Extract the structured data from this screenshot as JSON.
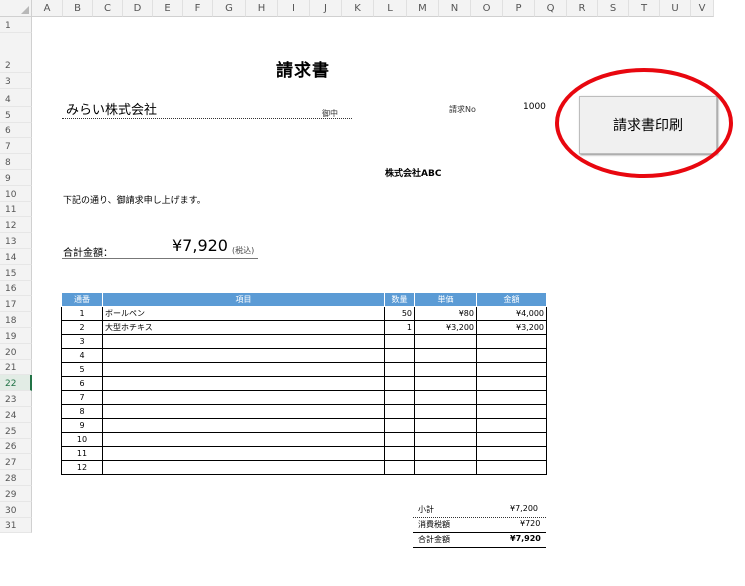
{
  "columns": [
    "A",
    "B",
    "C",
    "D",
    "E",
    "F",
    "G",
    "H",
    "I",
    "J",
    "K",
    "L",
    "M",
    "N",
    "O",
    "P",
    "Q",
    "R",
    "S",
    "T",
    "U",
    "V"
  ],
  "rows": [
    "1",
    "2",
    "3",
    "4",
    "5",
    "6",
    "7",
    "8",
    "9",
    "10",
    "11",
    "12",
    "13",
    "14",
    "15",
    "16",
    "17",
    "18",
    "19",
    "20",
    "21",
    "22",
    "23",
    "24",
    "25",
    "26",
    "27",
    "28",
    "29",
    "30",
    "31"
  ],
  "invoice": {
    "title": "請求書",
    "client": "みらい株式会社",
    "honorific": "御中",
    "invoice_no_label": "請求No",
    "invoice_no": "1000",
    "company": "株式会社ABC",
    "intro": "下記の通り、御請求申し上げます。",
    "total_label": "合計金額：",
    "total_amount": "¥7,920",
    "tax_note": "(税込)",
    "table_headers": [
      "通番",
      "項目",
      "数量",
      "単価",
      "金額"
    ],
    "items": [
      {
        "no": "1",
        "name": "ボールペン",
        "qty": "50",
        "price": "¥80",
        "amount": "¥4,000"
      },
      {
        "no": "2",
        "name": "大型ホチキス",
        "qty": "1",
        "price": "¥3,200",
        "amount": "¥3,200"
      },
      {
        "no": "3",
        "name": "",
        "qty": "",
        "price": "",
        "amount": ""
      },
      {
        "no": "4",
        "name": "",
        "qty": "",
        "price": "",
        "amount": ""
      },
      {
        "no": "5",
        "name": "",
        "qty": "",
        "price": "",
        "amount": ""
      },
      {
        "no": "6",
        "name": "",
        "qty": "",
        "price": "",
        "amount": ""
      },
      {
        "no": "7",
        "name": "",
        "qty": "",
        "price": "",
        "amount": ""
      },
      {
        "no": "8",
        "name": "",
        "qty": "",
        "price": "",
        "amount": ""
      },
      {
        "no": "9",
        "name": "",
        "qty": "",
        "price": "",
        "amount": ""
      },
      {
        "no": "10",
        "name": "",
        "qty": "",
        "price": "",
        "amount": ""
      },
      {
        "no": "11",
        "name": "",
        "qty": "",
        "price": "",
        "amount": ""
      },
      {
        "no": "12",
        "name": "",
        "qty": "",
        "price": "",
        "amount": ""
      }
    ],
    "subtotal_label": "小計",
    "subtotal": "¥7,200",
    "tax_label": "消費税額",
    "tax": "¥720",
    "grand_label": "合計金額",
    "grand_total": "¥7,920"
  },
  "print_button": {
    "label": "請求書印刷"
  },
  "selected_row": "22",
  "colors": {
    "header_blue": "#5b9bd5",
    "highlight_red": "#e8070f",
    "excel_green": "#217346"
  }
}
